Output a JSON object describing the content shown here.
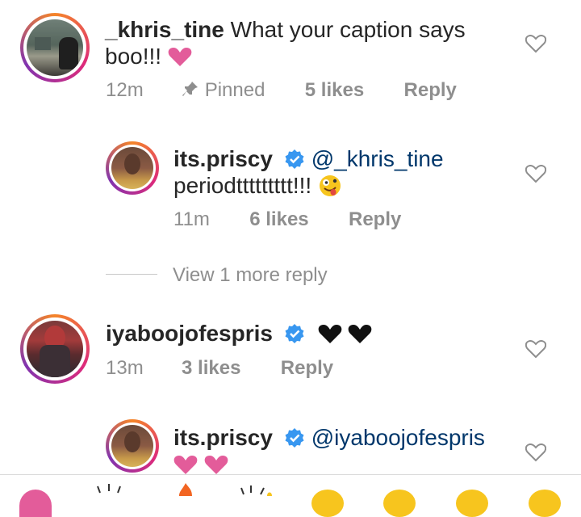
{
  "comments": [
    {
      "username": "_khris_tine",
      "text": "What your caption says boo!!!",
      "time": "12m",
      "pinned_label": "Pinned",
      "likes": "5 likes",
      "reply_label": "Reply"
    },
    {
      "username": "its.priscy",
      "verified": true,
      "mention": "@_khris_tine",
      "text": "periodttttttttt!!!",
      "time": "11m",
      "likes": "6 likes",
      "reply_label": "Reply"
    },
    {
      "username": "iyaboojofespris",
      "verified": true,
      "time": "13m",
      "likes": "3 likes",
      "reply_label": "Reply"
    },
    {
      "username": "its.priscy",
      "verified": true,
      "mention": "@iyaboojofespris"
    }
  ],
  "view_more_replies": "View 1 more reply",
  "colors": {
    "verified_blue": "#3897f0",
    "heart_pink": "#e35c9a",
    "meta_gray": "#8e8e8e",
    "mention_blue": "#00376b"
  },
  "icons": [
    "heart-outline-icon",
    "verified-badge-icon",
    "pin-icon",
    "pink-heart-emoji",
    "black-heart-emoji",
    "zany-face-emoji"
  ]
}
